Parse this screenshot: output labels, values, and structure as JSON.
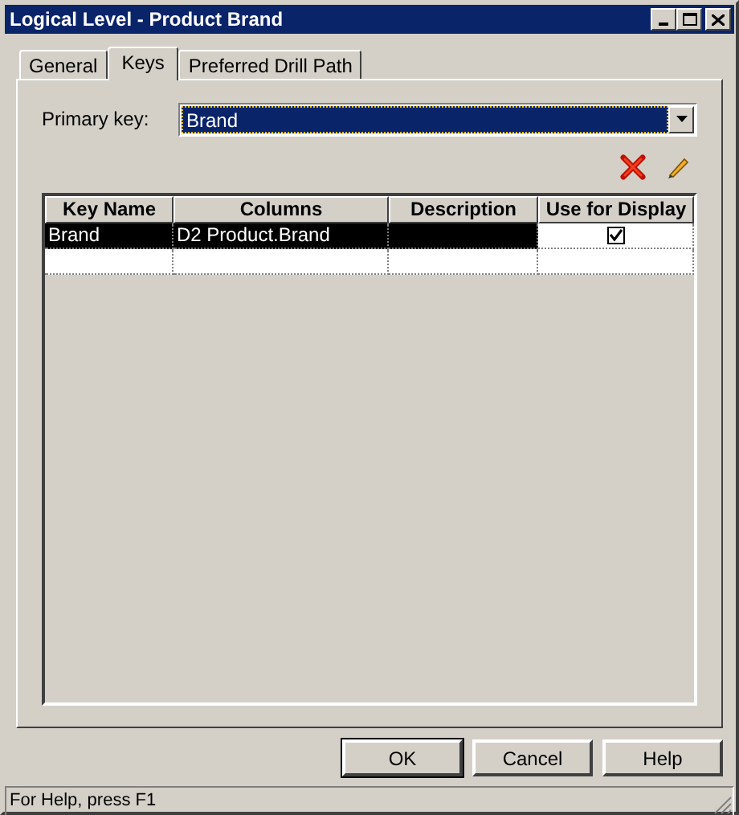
{
  "window": {
    "title": "Logical Level - Product Brand"
  },
  "tabs": [
    {
      "label": "General",
      "selected": false
    },
    {
      "label": "Keys",
      "selected": true
    },
    {
      "label": "Preferred Drill Path",
      "selected": false
    }
  ],
  "primary_key": {
    "label": "Primary key:",
    "value": "Brand"
  },
  "table": {
    "columns": [
      "Key Name",
      "Columns",
      "Description",
      "Use for Display"
    ],
    "rows": [
      {
        "key_name": "Brand",
        "columns": "D2 Product.Brand",
        "description": "",
        "use_for_display": true,
        "selected": true
      }
    ]
  },
  "buttons": [
    {
      "label": "OK",
      "default": true
    },
    {
      "label": "Cancel",
      "default": false
    },
    {
      "label": "Help",
      "default": false
    }
  ],
  "status_bar": "For Help, press F1"
}
